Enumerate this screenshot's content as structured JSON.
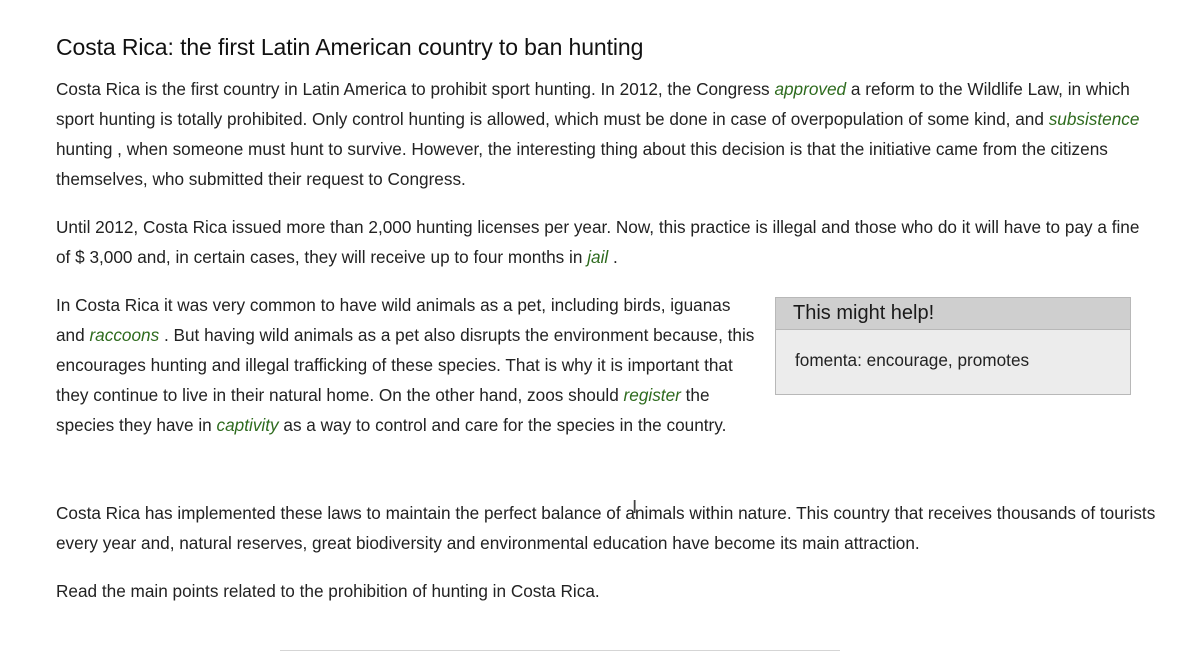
{
  "article": {
    "title": "Costa Rica: the first Latin American country to ban hunting",
    "p1": {
      "t1": "Costa Rica is the first country in Latin America to prohibit sport hunting. In 2012, the Congress ",
      "w1": "approved",
      "t2": " a reform to the Wildlife Law, in which sport hunting is totally prohibited. Only control hunting is allowed, which must be done in case of overpopulation of some kind, and ",
      "w2": "subsistence",
      "t3": " hunting , when someone must hunt to survive. However, the interesting thing about this decision is that the initiative came from the citizens themselves, who submitted their request to Congress."
    },
    "p2": {
      "t1": "Until 2012, Costa Rica issued more than 2,000 hunting licenses per year. Now, this practice is illegal and those who do it will have to pay a fine of $ 3,000 and, in certain cases, they will receive up to four months in ",
      "w1": "jail",
      "t2": " ."
    },
    "p3": {
      "t1": "In Costa Rica it was very common to have wild animals as a pet, including birds, iguanas and ",
      "w1": "raccoons",
      "t2": " . But having wild animals as a pet also disrupts the environment because, this encourages hunting and illegal trafficking of these species. That is why it is important that they continue to live in their natural home. On the other hand, zoos should ",
      "w2": "register",
      "t3": " the species they have in ",
      "w3": "captivity",
      "t4": " as a way to control and care for the species in the country."
    },
    "help_box": {
      "heading": "This might help!",
      "term": "fomenta:",
      "definition": " encourage, promotes"
    },
    "p4": "Costa Rica has implemented these laws to maintain the perfect balance of animals within nature. This country that receives thousands of tourists every year and, natural reserves, great biodiversity and environmental education have become its main attraction.",
    "p5": "Read the main points related to the prohibition of hunting in Costa Rica."
  },
  "colors": {
    "vocab_green": "#2e6b1e",
    "help_header_bg": "#cfcfcf",
    "help_body_bg": "#ececec"
  },
  "cursor": {
    "icon": "text-cursor-icon",
    "glyph": "I"
  }
}
